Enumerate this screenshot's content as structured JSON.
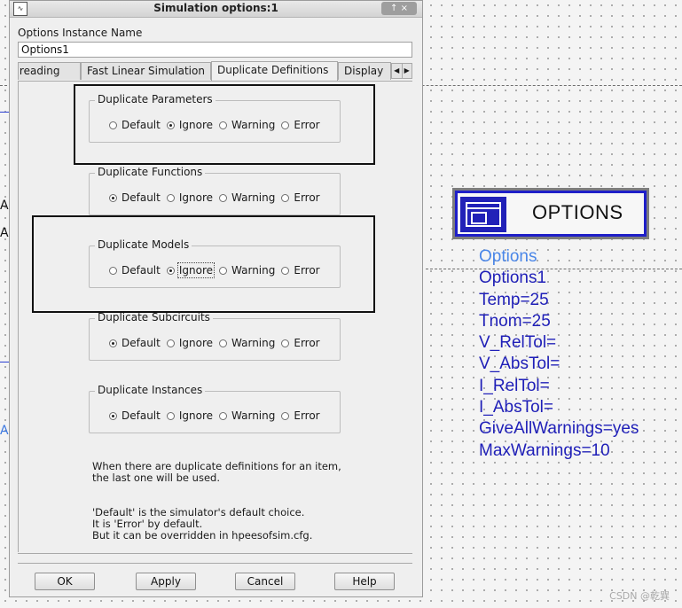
{
  "dialog": {
    "title": "Simulation options:1",
    "window_buttons": "↑ ×",
    "instance_label": "Options Instance Name",
    "instance_value": "Options1",
    "tabs": [
      {
        "label": "Threading"
      },
      {
        "label": "Fast Linear Simulation"
      },
      {
        "label": "Duplicate Definitions"
      },
      {
        "label": "Display"
      }
    ],
    "radio_options": [
      "Default",
      "Ignore",
      "Warning",
      "Error"
    ],
    "groups": [
      {
        "title": "Duplicate Parameters",
        "selected": "Ignore"
      },
      {
        "title": "Duplicate Functions",
        "selected": "Default"
      },
      {
        "title": "Duplicate Models",
        "selected": "Ignore"
      },
      {
        "title": "Duplicate Subcircuits",
        "selected": "Default"
      },
      {
        "title": "Duplicate Instances",
        "selected": "Default"
      }
    ],
    "note1": [
      "When there are duplicate definitions for an item,",
      "the last one will be used."
    ],
    "note2": [
      "'Default' is the simulator's default choice.",
      "It is 'Error' by default.",
      "But it can be overridden in hpeesofsim.cfg."
    ],
    "buttons": {
      "ok": "OK",
      "apply": "Apply",
      "cancel": "Cancel",
      "help": "Help"
    }
  },
  "schematic": {
    "edge_letters": [
      "A",
      "A",
      "A"
    ],
    "symbol_title": "OPTIONS",
    "symbol_icon": "window-icon",
    "params": [
      "Options",
      "Options1",
      "Temp=25",
      "Tnom=25",
      "V_RelTol=",
      "V_AbsTol=",
      "I_RelTol=",
      "I_AbsTol=",
      "GiveAllWarnings=yes",
      "MaxWarnings=10"
    ]
  },
  "watermark": "CSDN @乾巽",
  "colors": {
    "param_text": "#1f1fb8",
    "symbol_border": "#1f1fc8",
    "highlight_box": "#111111"
  }
}
